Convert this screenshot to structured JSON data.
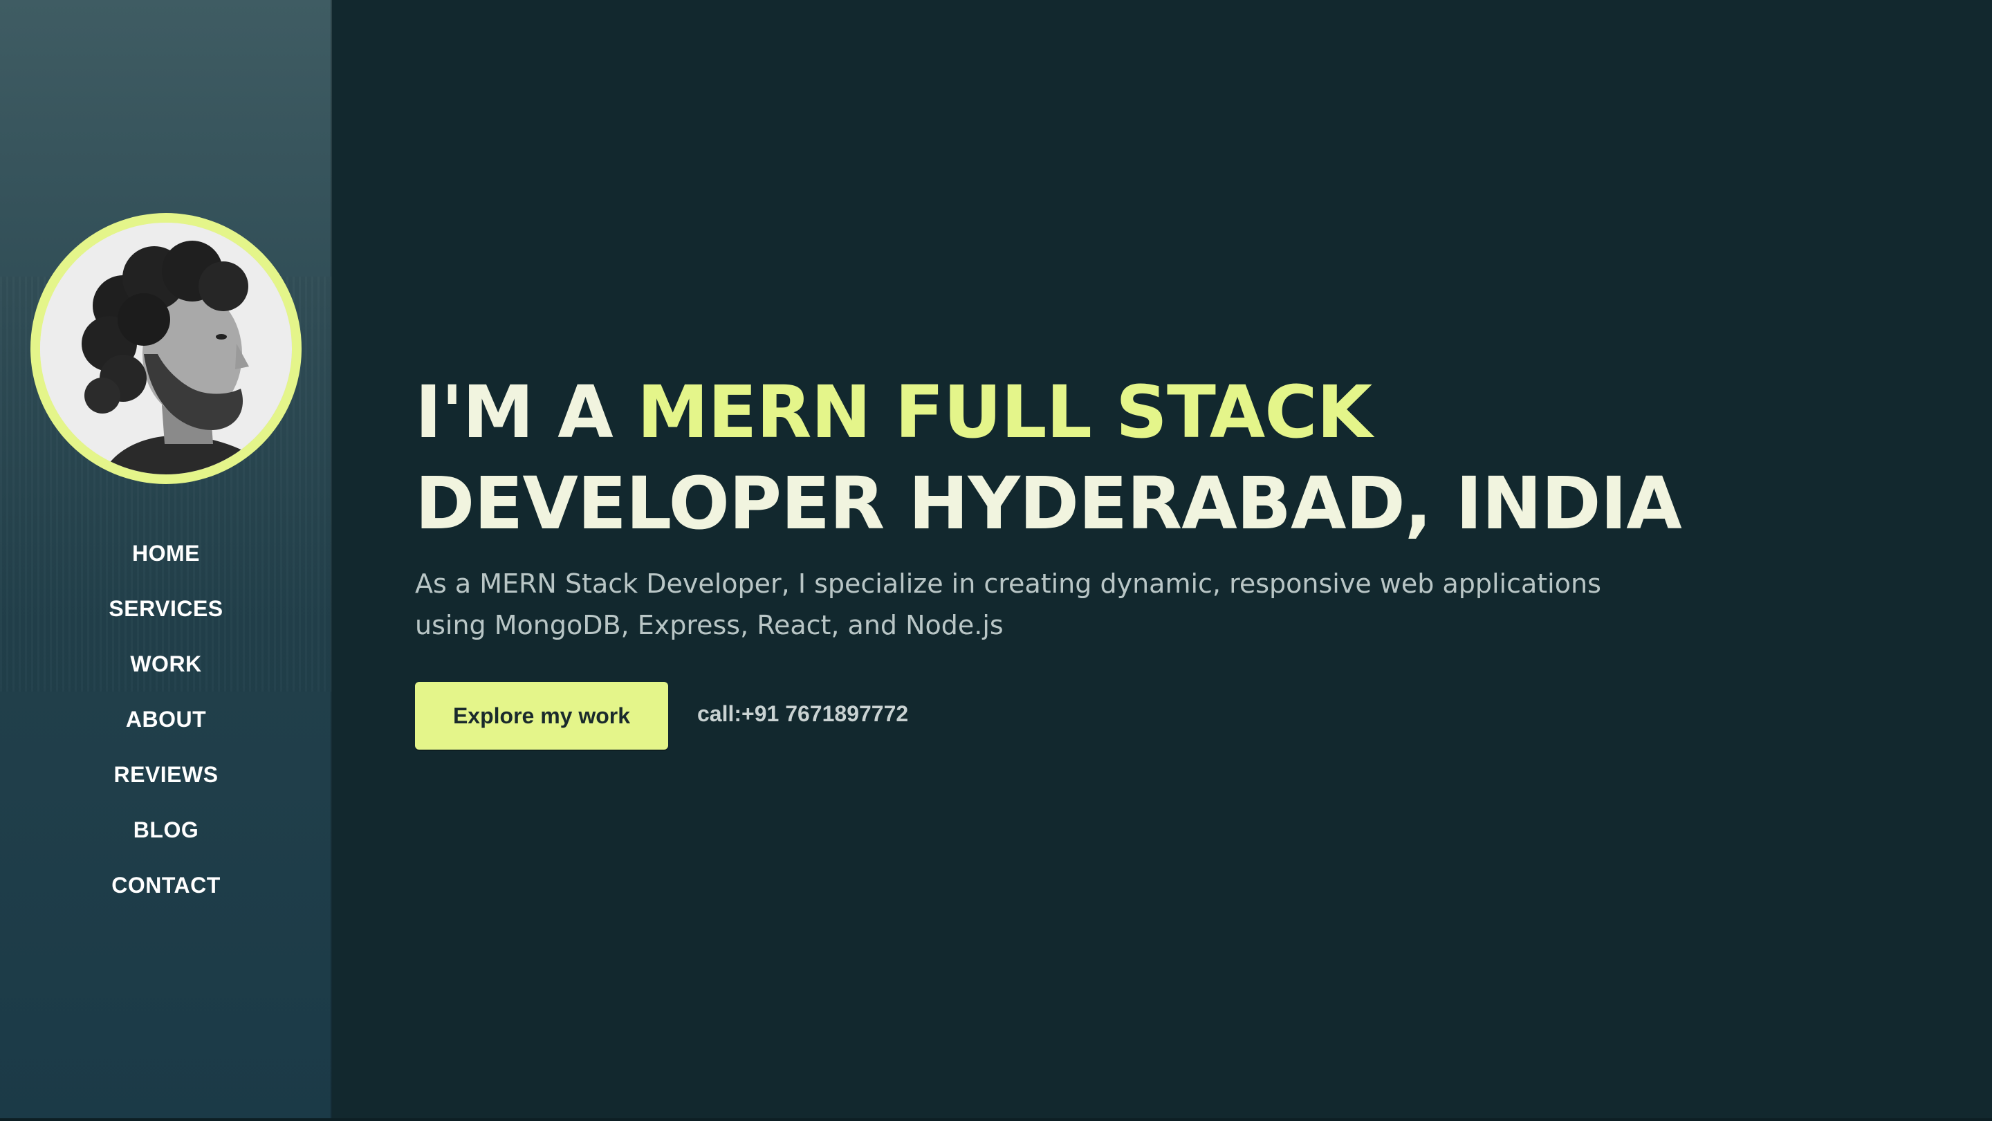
{
  "sidebar": {
    "avatar_icon": "portrait-photo",
    "nav_items": [
      {
        "label": "HOME"
      },
      {
        "label": "SERVICES"
      },
      {
        "label": "WORK"
      },
      {
        "label": "ABOUT"
      },
      {
        "label": "REVIEWS"
      },
      {
        "label": "BLOG"
      },
      {
        "label": "CONTACT"
      }
    ]
  },
  "hero": {
    "headline_prefix": "I'M A ",
    "headline_accent": "MERN FULL STACK",
    "headline_line2": "DEVELOPER HYDERABAD, INDIA",
    "description": "As a MERN Stack Developer, I specialize in creating dynamic, responsive web applications using MongoDB, Express, React, and Node.js",
    "cta_label": "Explore my work",
    "call_text": "call:+91 7671897772"
  },
  "colors": {
    "background": "#12282e",
    "accent": "#e4f58a",
    "headline": "#f1f4df",
    "sidebar": "#2f4c55"
  }
}
